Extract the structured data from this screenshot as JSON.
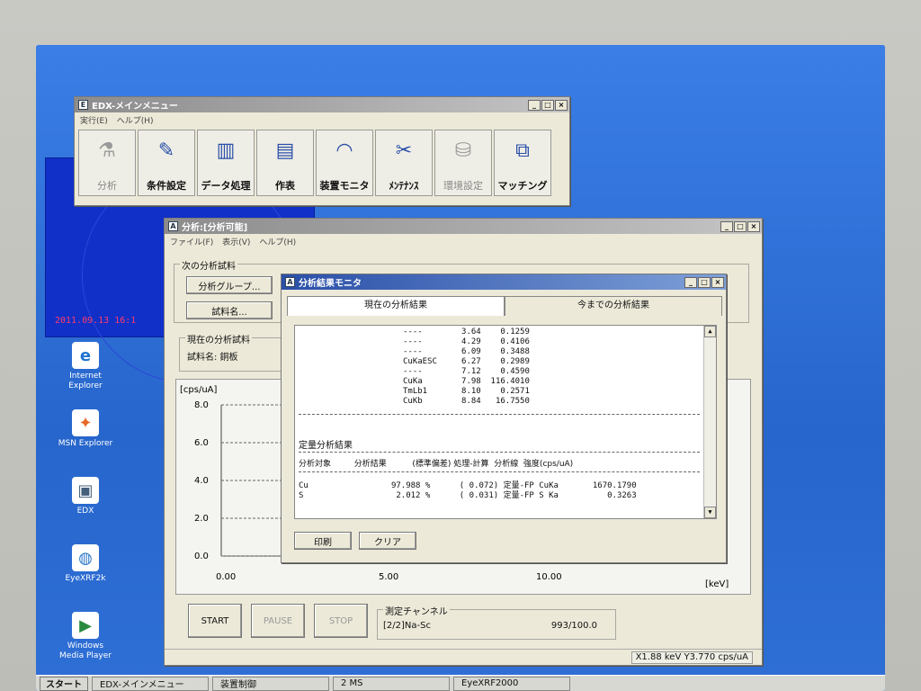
{
  "clock": "2011.09.13 16:1",
  "desktop_icons": [
    {
      "label": "Internet\nExplorer",
      "glyph": "e",
      "color": "#1e73d0"
    },
    {
      "label": "MSN Explorer",
      "glyph": "✦",
      "color": "#e86a2a"
    },
    {
      "label": "EDX",
      "glyph": "▣",
      "color": "#44607a"
    },
    {
      "label": "EyeXRF2k",
      "glyph": "◍",
      "color": "#2a76c9"
    },
    {
      "label": "Windows\nMedia Player",
      "glyph": "▶",
      "color": "#2b8a3e"
    }
  ],
  "main_window": {
    "title": "EDX-メインメニュー",
    "menu": [
      "実行(E)",
      "ヘルプ(H)"
    ],
    "toolbar": [
      {
        "label": "分析",
        "icon": "sample-icon",
        "disabled": true
      },
      {
        "label": "条件設定",
        "icon": "pencil-icon",
        "disabled": false
      },
      {
        "label": "データ処理",
        "icon": "spectrum-icon",
        "disabled": false
      },
      {
        "label": "作表",
        "icon": "table-icon",
        "disabled": false
      },
      {
        "label": "装置モニタ",
        "icon": "gauge-icon",
        "disabled": false
      },
      {
        "label": "ﾒﾝﾃﾅﾝｽ",
        "icon": "tools-icon",
        "disabled": false
      },
      {
        "label": "環境設定",
        "icon": "disk-icon",
        "disabled": true
      },
      {
        "label": "マッチング",
        "icon": "match-icon",
        "disabled": false
      }
    ]
  },
  "analysis_window": {
    "title": "分析:[分析可能]",
    "menu": [
      "ファイル(F)",
      "表示(V)",
      "ヘルプ(H)"
    ],
    "next_group_label": "次の分析試料",
    "group_button": "分析グループ...",
    "sample_button": "試料名...",
    "current_group_label": "現在の分析試料",
    "sample_name": "試料名: 銅板",
    "plot": {
      "y_unit": "[cps/uA]",
      "y_ticks": [
        "8.0",
        "6.0",
        "4.0",
        "2.0",
        "0.0"
      ],
      "x_ticks": [
        "0.00",
        "5.00",
        "10.00"
      ],
      "x_unit": "[keV]"
    },
    "start_button": "START",
    "pause_button": "PAUSE",
    "stop_button": "STOP",
    "channel_label": "測定チャンネル",
    "channel_value": "[2/2]Na-Sc",
    "channel_progress": "993/100.0",
    "status": "X1.88 keV  Y3.770 cps/uA"
  },
  "result_window": {
    "title": "分析結果モニタ",
    "tab_current": "現在の分析結果",
    "tab_history": "今までの分析結果",
    "peaks": [
      {
        "name": "----",
        "kev": "3.64",
        "cps": "0.1259"
      },
      {
        "name": "----",
        "kev": "4.29",
        "cps": "0.4106"
      },
      {
        "name": "----",
        "kev": "6.09",
        "cps": "0.3488"
      },
      {
        "name": "CuKaESC",
        "kev": "6.27",
        "cps": "0.2989"
      },
      {
        "name": "----",
        "kev": "7.12",
        "cps": "0.4590"
      },
      {
        "name": "CuKa",
        "kev": "7.98",
        "cps": "116.4010"
      },
      {
        "name": "TmLb1",
        "kev": "8.10",
        "cps": "0.2571"
      },
      {
        "name": "CuKb",
        "kev": "8.84",
        "cps": "16.7550"
      }
    ],
    "quant_title": "定量分析結果",
    "quant_header": "分析対象         分析結果          (標準偏差) 処理-計算  分析線  強度(cps/uA)",
    "quant_rows": [
      {
        "elem": "Cu",
        "result": "97.988 %",
        "sd": "( 0.072)",
        "proc": "定量-FP",
        "line": "CuKa",
        "intensity": "1670.1790"
      },
      {
        "elem": "S",
        "result": " 2.012 %",
        "sd": "( 0.031)",
        "proc": "定量-FP",
        "line": "S Ka",
        "intensity": "0.3263"
      }
    ],
    "print_button": "印刷",
    "clear_button": "クリア"
  },
  "taskbar": {
    "start": "スタート",
    "items": [
      "EDX-メインメニュー",
      "装置制御",
      "2 MS",
      "EyeXRF2000"
    ]
  }
}
